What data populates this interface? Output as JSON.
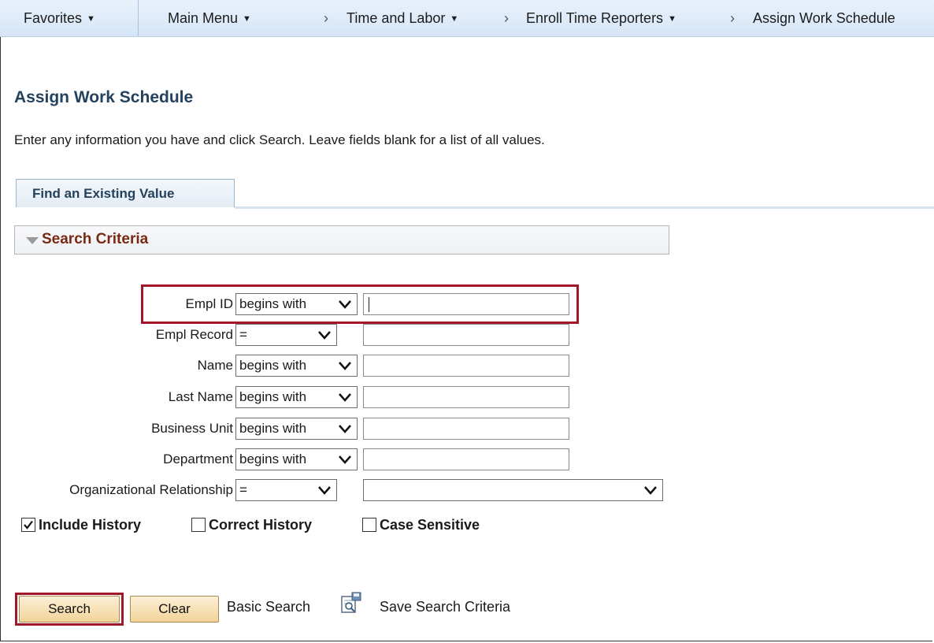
{
  "nav": {
    "favorites": "Favorites",
    "main_menu": "Main Menu",
    "breadcrumbs": [
      "Time and Labor",
      "Enroll Time Reporters",
      "Assign Work Schedule"
    ]
  },
  "page": {
    "title": "Assign Work Schedule",
    "instructions": "Enter any information you have and click Search. Leave fields blank for a list of all values."
  },
  "tab": {
    "label": "Find an Existing Value"
  },
  "criteria": {
    "title": "Search Criteria"
  },
  "fields": {
    "empl_id": {
      "label": "Empl ID",
      "operator": "begins with",
      "value": ""
    },
    "empl_record": {
      "label": "Empl Record",
      "operator": "=",
      "value": ""
    },
    "name": {
      "label": "Name",
      "operator": "begins with",
      "value": ""
    },
    "last_name": {
      "label": "Last Name",
      "operator": "begins with",
      "value": ""
    },
    "business_unit": {
      "label": "Business Unit",
      "operator": "begins with",
      "value": ""
    },
    "department": {
      "label": "Department",
      "operator": "begins with",
      "value": ""
    },
    "org_relationship": {
      "label": "Organizational Relationship",
      "operator": "=",
      "value": ""
    }
  },
  "checkboxes": {
    "include_history": {
      "label": "Include History",
      "checked": true
    },
    "correct_history": {
      "label": "Correct History",
      "checked": false
    },
    "case_sensitive": {
      "label": "Case Sensitive",
      "checked": false
    }
  },
  "actions": {
    "search": "Search",
    "clear": "Clear",
    "basic_search": "Basic Search",
    "save_search": "Save Search Criteria"
  },
  "colors": {
    "highlight": "#a3172a",
    "title": "#23425d",
    "criteria_title": "#7a2a12"
  }
}
